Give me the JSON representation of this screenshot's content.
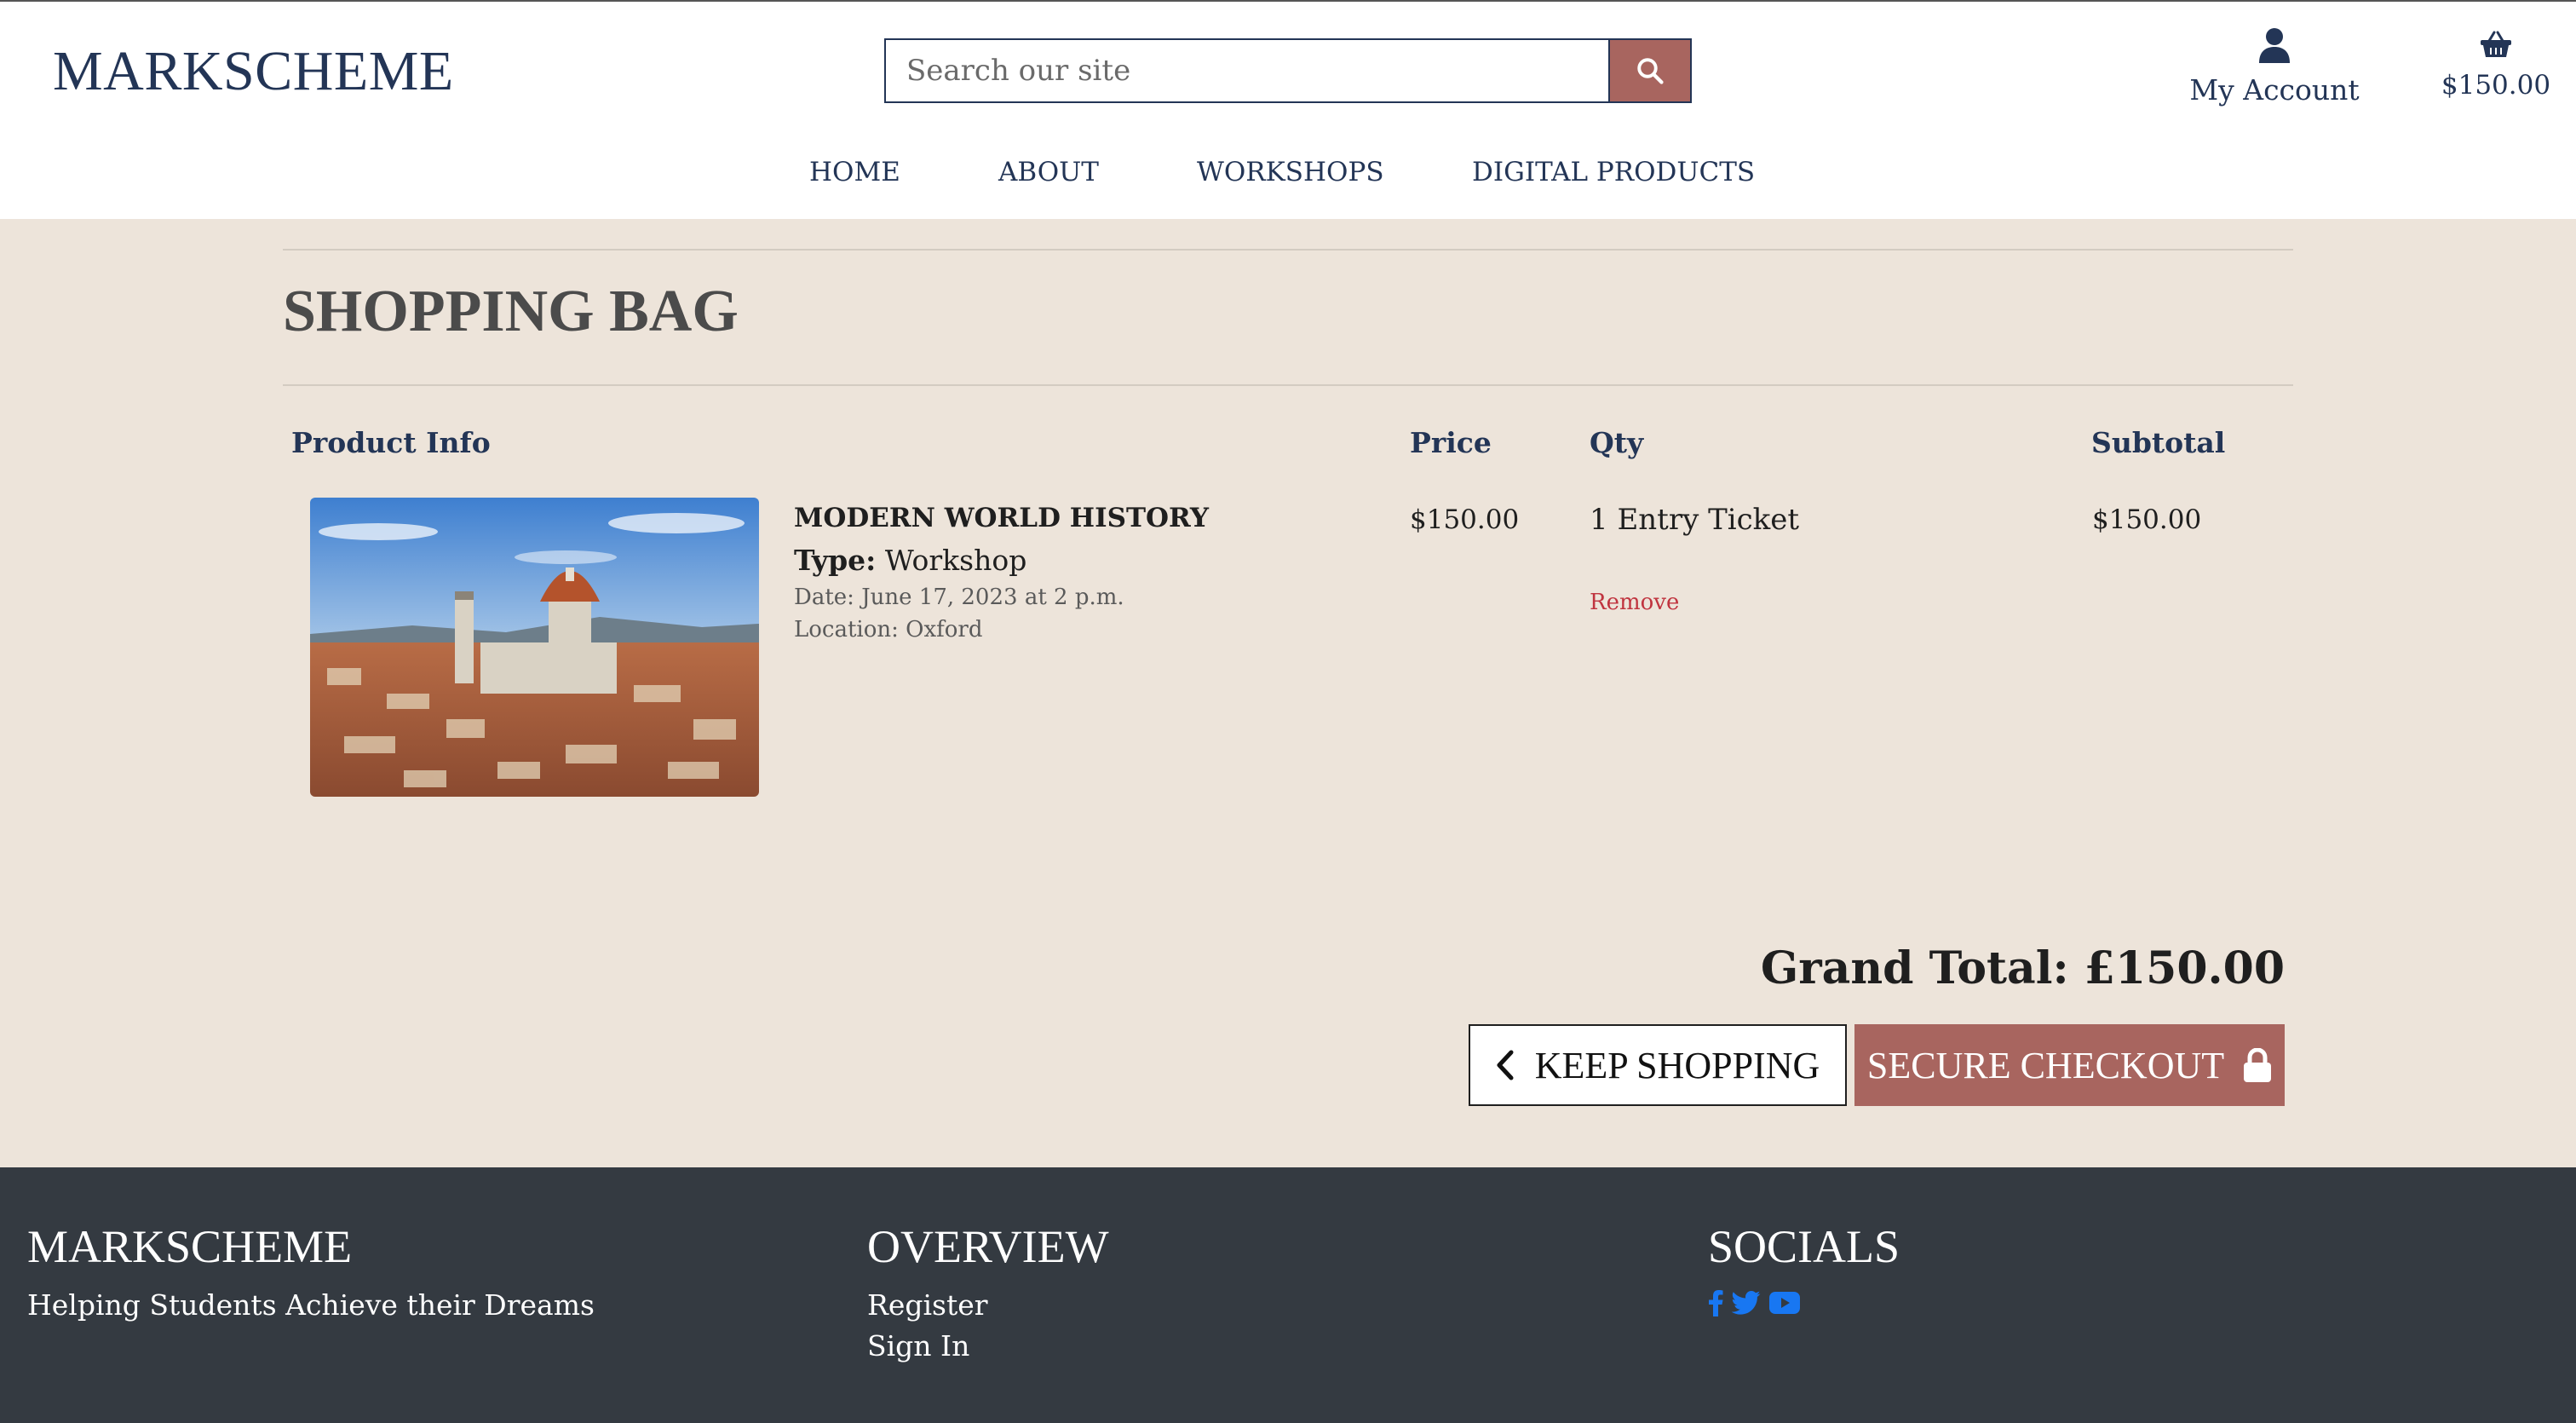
{
  "header": {
    "logo": "MARKSCHEME",
    "search_placeholder": "Search our site",
    "account_label": "My Account",
    "bag_total": "$150.00"
  },
  "nav": [
    "HOME",
    "ABOUT",
    "WORKSHOPS",
    "DIGITAL PRODUCTS"
  ],
  "page_title": "SHOPPING BAG",
  "table": {
    "headers": [
      "Product Info",
      "Price",
      "Qty",
      "Subtotal"
    ],
    "items": [
      {
        "name": "MODERN WORLD HISTORY",
        "type_label": "Type:",
        "type_value": "Workshop",
        "date": "Date: June 17, 2023 at 2 p.m.",
        "location": "Location: Oxford",
        "price": "$150.00",
        "qty": "1 Entry Ticket",
        "remove_label": "Remove",
        "subtotal": "$150.00",
        "image_icon": "cathedral-photo"
      }
    ]
  },
  "grand_total": "Grand Total: £150.00",
  "buttons": {
    "keep_shopping": "KEEP SHOPPING",
    "secure_checkout": "SECURE CHECKOUT"
  },
  "footer": {
    "brand_heading": "MARKSCHEME",
    "tagline": "Helping Students Achieve their Dreams",
    "overview_heading": "OVERVIEW",
    "overview_links": [
      "Register",
      "Sign In"
    ],
    "socials_heading": "SOCIALS",
    "social_icons": [
      "facebook-icon",
      "twitter-icon",
      "youtube-icon"
    ]
  },
  "colors": {
    "brand_navy": "#233556",
    "accent": "#a8655f",
    "page_bg": "#ede4da",
    "footer_bg": "#343a41",
    "social_blue": "#1877f2",
    "remove_red": "#c0343f"
  }
}
